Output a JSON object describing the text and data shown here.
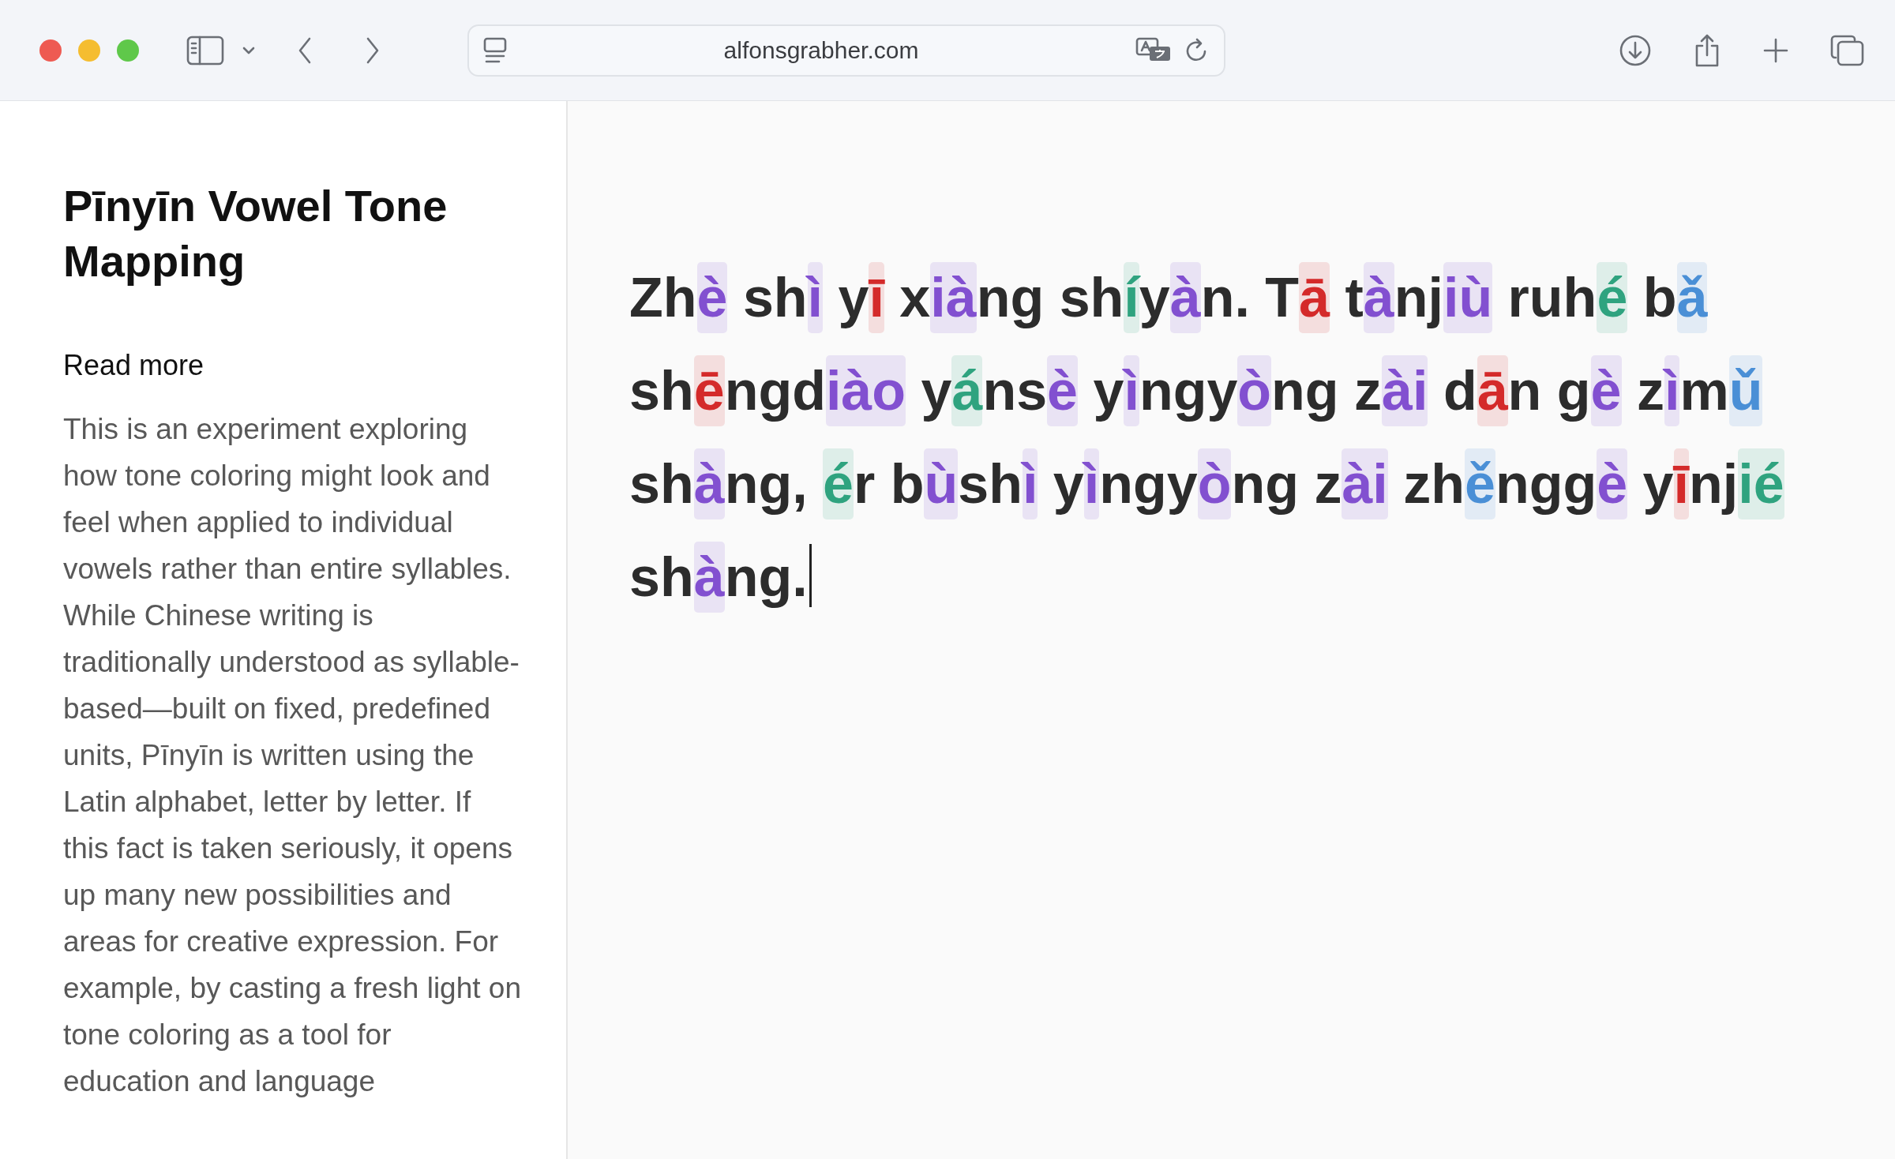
{
  "toolbar": {
    "url": "alfonsgrabher.com"
  },
  "sidebar": {
    "title": "Pīnyīn Vowel Tone Mapping",
    "read_more": "Read more",
    "description": "This is an experiment exploring how tone coloring might look and feel when applied to individual vowels rather than entire syllables. While Chinese writing is traditionally understood as syllable-based—built on fixed, predefined units, Pīnyīn is written using the Latin alphabet, letter by letter. If this fact is taken seriously, it opens up many new possibilities and areas for creative expression. For example, by casting a fresh light on tone coloring as a tool for education and language"
  },
  "editor": {
    "segments": [
      {
        "text": "Zh"
      },
      {
        "text": "è",
        "color": "#8250d0"
      },
      {
        "text": " sh"
      },
      {
        "text": "ì",
        "color": "#8250d0"
      },
      {
        "text": " y"
      },
      {
        "text": "ī",
        "color": "#d42a2a"
      },
      {
        "text": " x"
      },
      {
        "text": "ià",
        "color": "#8250d0"
      },
      {
        "text": "ng sh"
      },
      {
        "text": "í",
        "color": "#2fa37f"
      },
      {
        "text": "y"
      },
      {
        "text": "à",
        "color": "#8250d0"
      },
      {
        "text": "n. T"
      },
      {
        "text": "ā",
        "color": "#d42a2a"
      },
      {
        "text": " t"
      },
      {
        "text": "à",
        "color": "#8250d0"
      },
      {
        "text": "nj"
      },
      {
        "text": "iù",
        "color": "#8250d0"
      },
      {
        "text": " ruh"
      },
      {
        "text": "é",
        "color": "#2fa37f"
      },
      {
        "text": " b"
      },
      {
        "text": "ǎ",
        "color": "#4a8fd6"
      },
      {
        "text": " sh"
      },
      {
        "text": "ē",
        "color": "#d42a2a"
      },
      {
        "text": "ngd"
      },
      {
        "text": "iào",
        "color": "#8250d0"
      },
      {
        "text": " y"
      },
      {
        "text": "á",
        "color": "#2fa37f"
      },
      {
        "text": "ns"
      },
      {
        "text": "è",
        "color": "#8250d0"
      },
      {
        "text": " y"
      },
      {
        "text": "ì",
        "color": "#8250d0"
      },
      {
        "text": "ngy"
      },
      {
        "text": "ò",
        "color": "#8250d0"
      },
      {
        "text": "ng z"
      },
      {
        "text": "ài",
        "color": "#8250d0"
      },
      {
        "text": " d"
      },
      {
        "text": "ā",
        "color": "#d42a2a"
      },
      {
        "text": "n g"
      },
      {
        "text": "è",
        "color": "#8250d0"
      },
      {
        "text": " z"
      },
      {
        "text": "ì",
        "color": "#8250d0"
      },
      {
        "text": "m"
      },
      {
        "text": "ǔ",
        "color": "#4a8fd6"
      },
      {
        "text": " sh"
      },
      {
        "text": "à",
        "color": "#8250d0"
      },
      {
        "text": "ng, "
      },
      {
        "text": "é",
        "color": "#2fa37f"
      },
      {
        "text": "r b"
      },
      {
        "text": "ù",
        "color": "#8250d0"
      },
      {
        "text": "sh"
      },
      {
        "text": "ì",
        "color": "#8250d0"
      },
      {
        "text": " y"
      },
      {
        "text": "ì",
        "color": "#8250d0"
      },
      {
        "text": "ngy"
      },
      {
        "text": "ò",
        "color": "#8250d0"
      },
      {
        "text": "ng z"
      },
      {
        "text": "ài",
        "color": "#8250d0"
      },
      {
        "text": " zh"
      },
      {
        "text": "ě",
        "color": "#4a8fd6"
      },
      {
        "text": "ngg"
      },
      {
        "text": "è",
        "color": "#8250d0"
      },
      {
        "text": " y"
      },
      {
        "text": "ī",
        "color": "#d42a2a"
      },
      {
        "text": "nj"
      },
      {
        "text": "ié",
        "color": "#2fa37f"
      },
      {
        "text": " sh"
      },
      {
        "text": "à",
        "color": "#8250d0"
      },
      {
        "text": "ng."
      }
    ]
  }
}
